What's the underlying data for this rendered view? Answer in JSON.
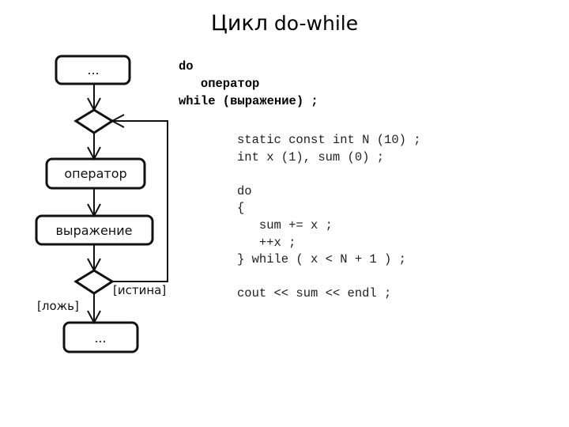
{
  "title": {
    "prefix": "Цикл",
    "suffix": "do-while"
  },
  "flowchart": {
    "start_box": "...",
    "operator_box": "оператор",
    "expression_box": "выражение",
    "end_box": "...",
    "true_label": "[истина]",
    "false_label": "[ложь]"
  },
  "syntax": {
    "lines": [
      "do",
      "   оператор",
      "while (выражение) ;"
    ]
  },
  "example_code": {
    "lines": [
      "static const int N (10) ;",
      "int x (1), sum (0) ;",
      "",
      "do",
      "{",
      "   sum += x ;",
      "   ++x ;",
      "} while ( x < N + 1 ) ;",
      "",
      "cout << sum << endl ;"
    ]
  }
}
